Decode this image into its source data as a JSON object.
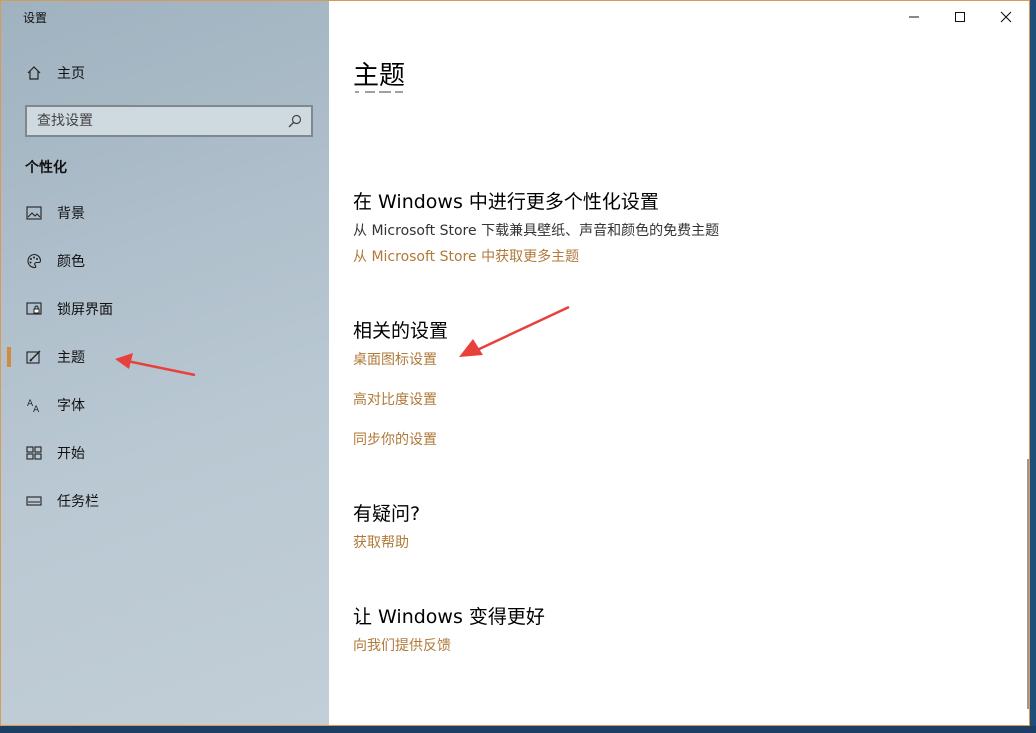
{
  "window": {
    "title": "设置"
  },
  "sidebar": {
    "home_label": "主页",
    "search_placeholder": "查找设置",
    "section_title": "个性化",
    "items": [
      {
        "label": "背景",
        "icon": "picture-icon"
      },
      {
        "label": "颜色",
        "icon": "palette-icon"
      },
      {
        "label": "锁屏界面",
        "icon": "lock-screen-icon"
      },
      {
        "label": "主题",
        "icon": "theme-icon",
        "active": true
      },
      {
        "label": "字体",
        "icon": "font-icon"
      },
      {
        "label": "开始",
        "icon": "start-icon"
      },
      {
        "label": "任务栏",
        "icon": "taskbar-icon"
      }
    ]
  },
  "main": {
    "title": "主题",
    "more_personalization": {
      "heading": "在 Windows 中进行更多个性化设置",
      "description": "从 Microsoft Store 下载兼具壁纸、声音和颜色的免费主题",
      "link": "从 Microsoft Store 中获取更多主题"
    },
    "related_settings": {
      "heading": "相关的设置",
      "links": [
        "桌面图标设置",
        "高对比度设置",
        "同步你的设置"
      ]
    },
    "questions": {
      "heading": "有疑问?",
      "link": "获取帮助"
    },
    "improve": {
      "heading": "让 Windows 变得更好",
      "link": "向我们提供反馈"
    }
  },
  "colors": {
    "accent": "#d28a3c",
    "link": "#b07a3a",
    "annotation_arrow": "#e8413c"
  }
}
